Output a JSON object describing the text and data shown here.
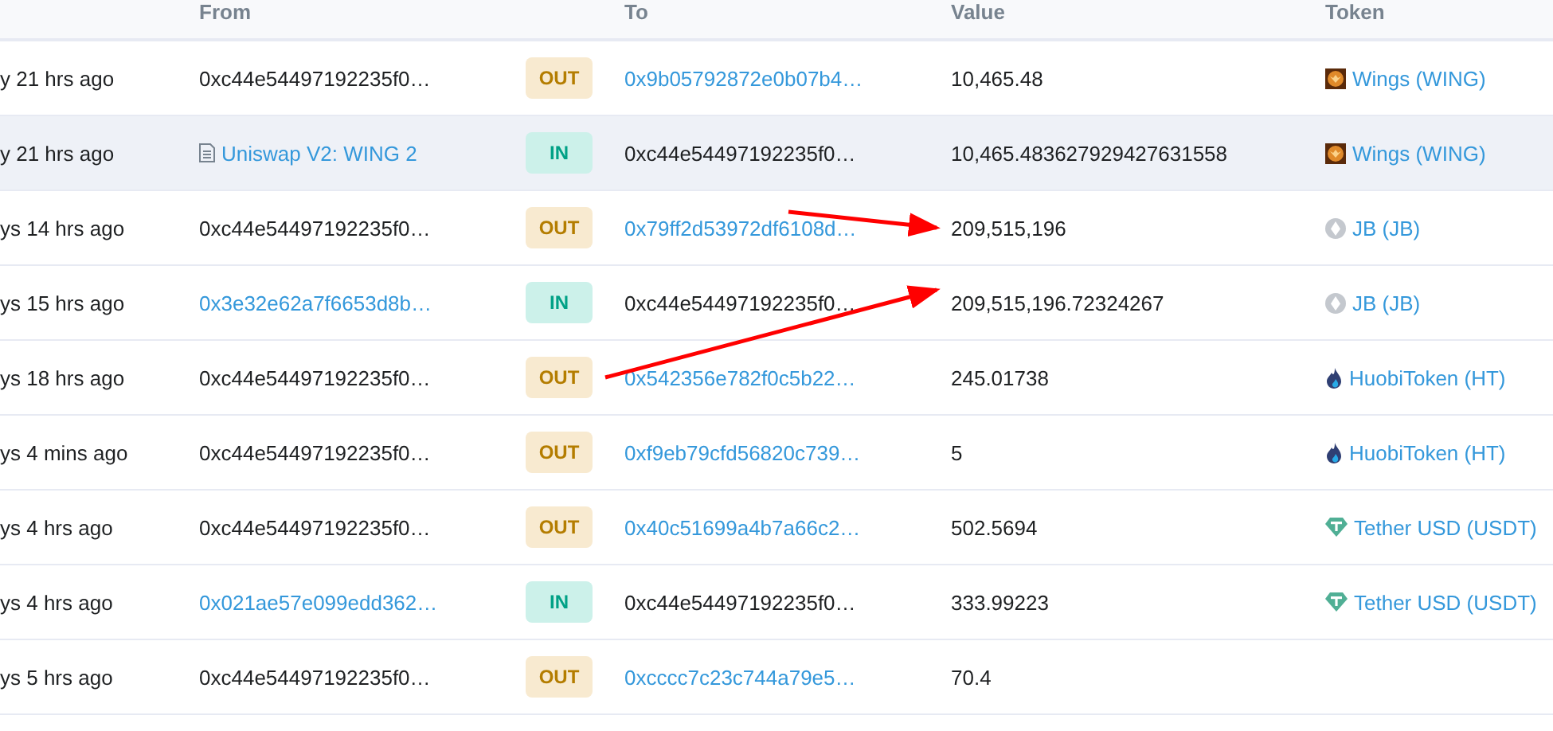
{
  "table": {
    "columns": [
      {
        "label": "From"
      },
      {
        "label": "To"
      },
      {
        "label": "Value"
      },
      {
        "label": "Token"
      }
    ],
    "rows": [
      {
        "age": "y 21 hrs ago",
        "from": {
          "text": "0xc44e54497192235f0…",
          "link": false
        },
        "direction": "OUT",
        "to": {
          "text": "0x9b05792872e0b07b4…",
          "link": true
        },
        "value": "10,465.48",
        "token": {
          "name": "Wings (WING)",
          "kind": "wing"
        },
        "highlighted": false
      },
      {
        "age": "y 21 hrs ago",
        "from": {
          "text": "Uniswap V2: WING 2",
          "link": true,
          "contract": true
        },
        "direction": "IN",
        "to": {
          "text": "0xc44e54497192235f0…",
          "link": false
        },
        "value": "10,465.483627929427631558",
        "token": {
          "name": "Wings (WING)",
          "kind": "wing"
        },
        "highlighted": true
      },
      {
        "age": "ys 14 hrs ago",
        "from": {
          "text": "0xc44e54497192235f0…",
          "link": false
        },
        "direction": "OUT",
        "to": {
          "text": "0x79ff2d53972df6108d…",
          "link": true
        },
        "value": "209,515,196",
        "token": {
          "name": "JB (JB)",
          "kind": "eth"
        },
        "highlighted": false
      },
      {
        "age": "ys 15 hrs ago",
        "from": {
          "text": "0x3e32e62a7f6653d8b…",
          "link": true
        },
        "direction": "IN",
        "to": {
          "text": "0xc44e54497192235f0…",
          "link": false
        },
        "value": "209,515,196.72324267",
        "token": {
          "name": "JB (JB)",
          "kind": "eth"
        },
        "highlighted": false
      },
      {
        "age": "ys 18 hrs ago",
        "from": {
          "text": "0xc44e54497192235f0…",
          "link": false
        },
        "direction": "OUT",
        "to": {
          "text": "0x542356e782f0c5b22…",
          "link": true
        },
        "value": "245.01738",
        "token": {
          "name": "HuobiToken (HT)",
          "kind": "flame"
        },
        "highlighted": false
      },
      {
        "age": "ys 4 mins ago",
        "from": {
          "text": "0xc44e54497192235f0…",
          "link": false
        },
        "direction": "OUT",
        "to": {
          "text": "0xf9eb79cfd56820c739…",
          "link": true
        },
        "value": "5",
        "token": {
          "name": "HuobiToken (HT)",
          "kind": "flame"
        },
        "highlighted": false
      },
      {
        "age": "ys 4 hrs ago",
        "from": {
          "text": "0xc44e54497192235f0…",
          "link": false
        },
        "direction": "OUT",
        "to": {
          "text": "0x40c51699a4b7a66c2…",
          "link": true
        },
        "value": "502.5694",
        "token": {
          "name": "Tether USD (USDT)",
          "kind": "tether"
        },
        "highlighted": false
      },
      {
        "age": "ys 4 hrs ago",
        "from": {
          "text": "0x021ae57e099edd362…",
          "link": true
        },
        "direction": "IN",
        "to": {
          "text": "0xc44e54497192235f0…",
          "link": false
        },
        "value": "333.99223",
        "token": {
          "name": "Tether USD (USDT)",
          "kind": "tether"
        },
        "highlighted": false
      },
      {
        "age": "ys 5 hrs ago",
        "from": {
          "text": "0xc44e54497192235f0…",
          "link": false
        },
        "direction": "OUT",
        "to": {
          "text": "0xcccc7c23c744a79e5…",
          "link": true
        },
        "value": "70.4",
        "highlighted": false
      }
    ],
    "annotations": [
      {
        "kind": "arrow"
      },
      {
        "kind": "arrow"
      }
    ]
  }
}
